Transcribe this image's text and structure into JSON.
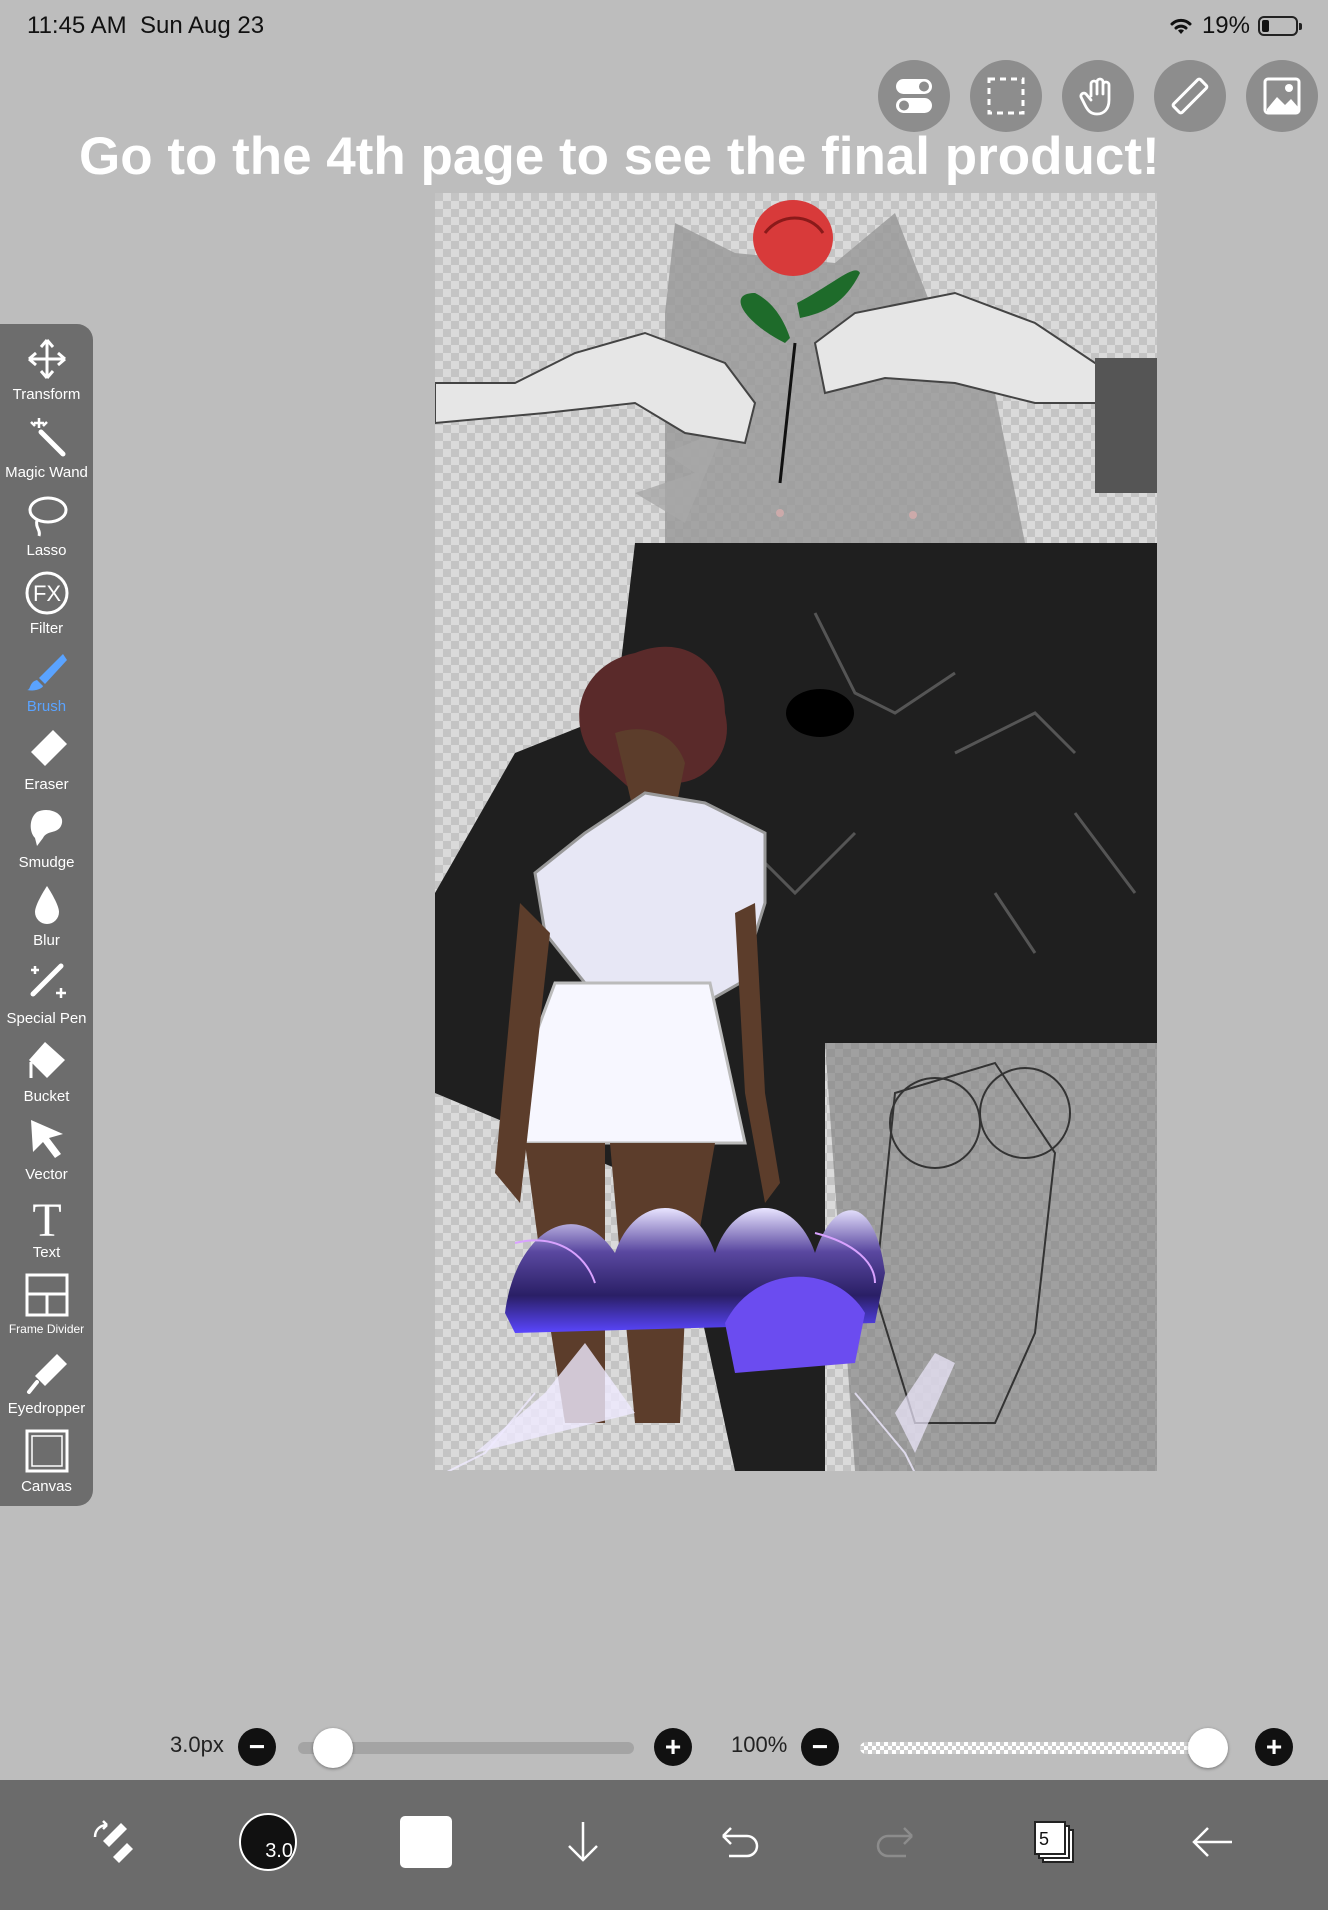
{
  "status_bar": {
    "time": "11:45 AM",
    "date": "Sun Aug 23",
    "battery": "19%"
  },
  "top_tools": [
    {
      "name": "toggle-icon"
    },
    {
      "name": "selection-icon"
    },
    {
      "name": "hand-icon"
    },
    {
      "name": "ruler-icon"
    },
    {
      "name": "material-icon"
    }
  ],
  "headline": "Go to the 4th page to see the final product!",
  "tools": [
    {
      "id": "transform",
      "label": "Transform",
      "icon": "move-icon"
    },
    {
      "id": "magic-wand",
      "label": "Magic Wand",
      "icon": "magic-wand-icon"
    },
    {
      "id": "lasso",
      "label": "Lasso",
      "icon": "lasso-icon"
    },
    {
      "id": "filter",
      "label": "Filter",
      "icon": "fx-icon"
    },
    {
      "id": "brush",
      "label": "Brush",
      "icon": "brush-icon",
      "active": true
    },
    {
      "id": "eraser",
      "label": "Eraser",
      "icon": "eraser-icon"
    },
    {
      "id": "smudge",
      "label": "Smudge",
      "icon": "smudge-icon"
    },
    {
      "id": "blur",
      "label": "Blur",
      "icon": "droplet-icon"
    },
    {
      "id": "special-pen",
      "label": "Special Pen",
      "icon": "special-pen-icon"
    },
    {
      "id": "bucket",
      "label": "Bucket",
      "icon": "bucket-icon"
    },
    {
      "id": "vector",
      "label": "Vector",
      "icon": "cursor-icon"
    },
    {
      "id": "text",
      "label": "Text",
      "icon": "text-icon"
    },
    {
      "id": "frame-divider",
      "label": "Frame Divider",
      "icon": "frame-divider-icon"
    },
    {
      "id": "eyedropper",
      "label": "Eyedropper",
      "icon": "eyedropper-icon"
    },
    {
      "id": "canvas",
      "label": "Canvas",
      "icon": "canvas-icon"
    }
  ],
  "brush_size": {
    "label": "3.0px",
    "value": 3.0,
    "fraction": 0.05
  },
  "opacity": {
    "label": "100%",
    "fraction": 1.0
  },
  "bottom_bar": {
    "brush_size_badge": "3.0",
    "layer_count": "5",
    "color": "#ffffff"
  }
}
